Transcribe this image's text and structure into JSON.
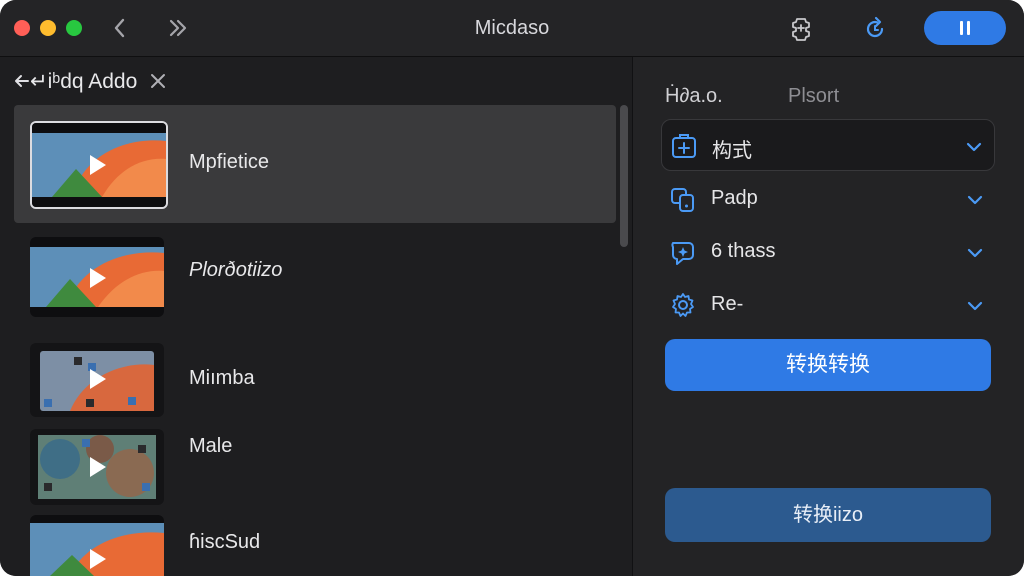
{
  "window": {
    "title": "Micdaso",
    "traffic_lights": [
      "#ff5f57",
      "#febc2e",
      "#28c840"
    ],
    "accent": "#2f7ae5"
  },
  "toolbar": {
    "back_icon": "chevron-left-icon",
    "forward_icon": "double-chevron-right-icon",
    "settings_icon": "puzzle-gear-icon",
    "refresh_icon": "refresh-icon",
    "pause_icon": "pause-icon"
  },
  "left_panel": {
    "header_title": "↵iᵇdq Addo",
    "back_icon": "arrow-left-icon",
    "close_icon": "close-icon",
    "items": [
      {
        "label": "Mpfietice",
        "selected": true
      },
      {
        "label": "Plorðotiizo",
        "selected": false
      },
      {
        "label": "Miımba",
        "selected": false
      },
      {
        "label": "Male",
        "selected": false
      },
      {
        "label": "ɦiscSud",
        "selected": false
      }
    ]
  },
  "right_panel": {
    "col1": "Ḣ∂a.o.",
    "col2": "Plsort",
    "options": [
      {
        "label": "构式",
        "icon": "plus-square-icon"
      },
      {
        "label": "Padp",
        "icon": "device-copy-icon"
      },
      {
        "label": "6 thass",
        "icon": "sparkle-shield-icon"
      },
      {
        "label": "Re-",
        "icon": "gear-icon"
      }
    ],
    "primary_button": "转换转换",
    "secondary_button": "转换iizo"
  }
}
